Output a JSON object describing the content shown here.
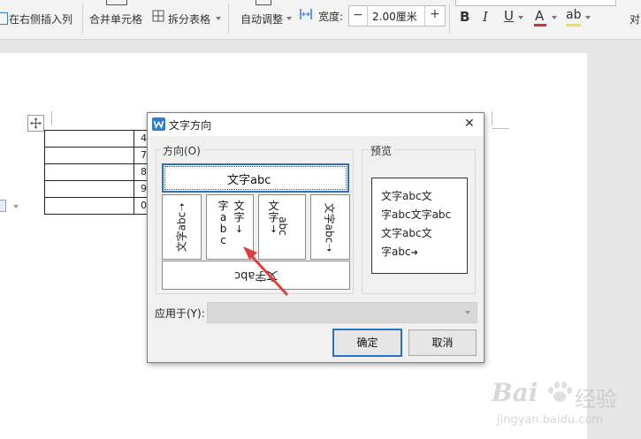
{
  "toolbar": {
    "insert_right": "在右侧插入列",
    "merge_cells": "合并单元格",
    "split_table": "拆分表格",
    "auto_adjust": "自动调整",
    "width_label": "宽度:",
    "width_value": "2.00厘米",
    "minus": "−",
    "plus": "+",
    "bold": "B",
    "italic": "I",
    "underline": "U",
    "font_color": "A",
    "highlight": "ab",
    "align_partial": "对"
  },
  "table": {
    "cells": [
      "4",
      "7",
      "8",
      "9",
      "0"
    ]
  },
  "dialog": {
    "title": "文字方向",
    "close": "✕",
    "direction_label": "方向(O)",
    "preview_label": "预览",
    "options": {
      "horizontal": "文字abc",
      "rot_up": "文字abc",
      "vert_stack_a_top": "文字",
      "vert_stack_a_bottom": "字abc",
      "vert_stack_b_top": "文字",
      "vert_stack_b_bottom": "abc",
      "rot_down": "文字abc",
      "flipped": "文字abc"
    },
    "preview_lines": [
      "文字abc文",
      "字abc文字abc",
      "文字abc文",
      "字abc"
    ],
    "apply_label": "应用于(Y):",
    "apply_value": "",
    "ok": "确定",
    "cancel": "取消"
  },
  "watermark": {
    "brand": "Bai",
    "brand_cn": "经验",
    "url": "jingyan.baidu.com"
  },
  "colors": {
    "accent_blue": "#2b7cd3",
    "arrow_red": "#e0403a",
    "ok_border": "#2b6fc7"
  }
}
